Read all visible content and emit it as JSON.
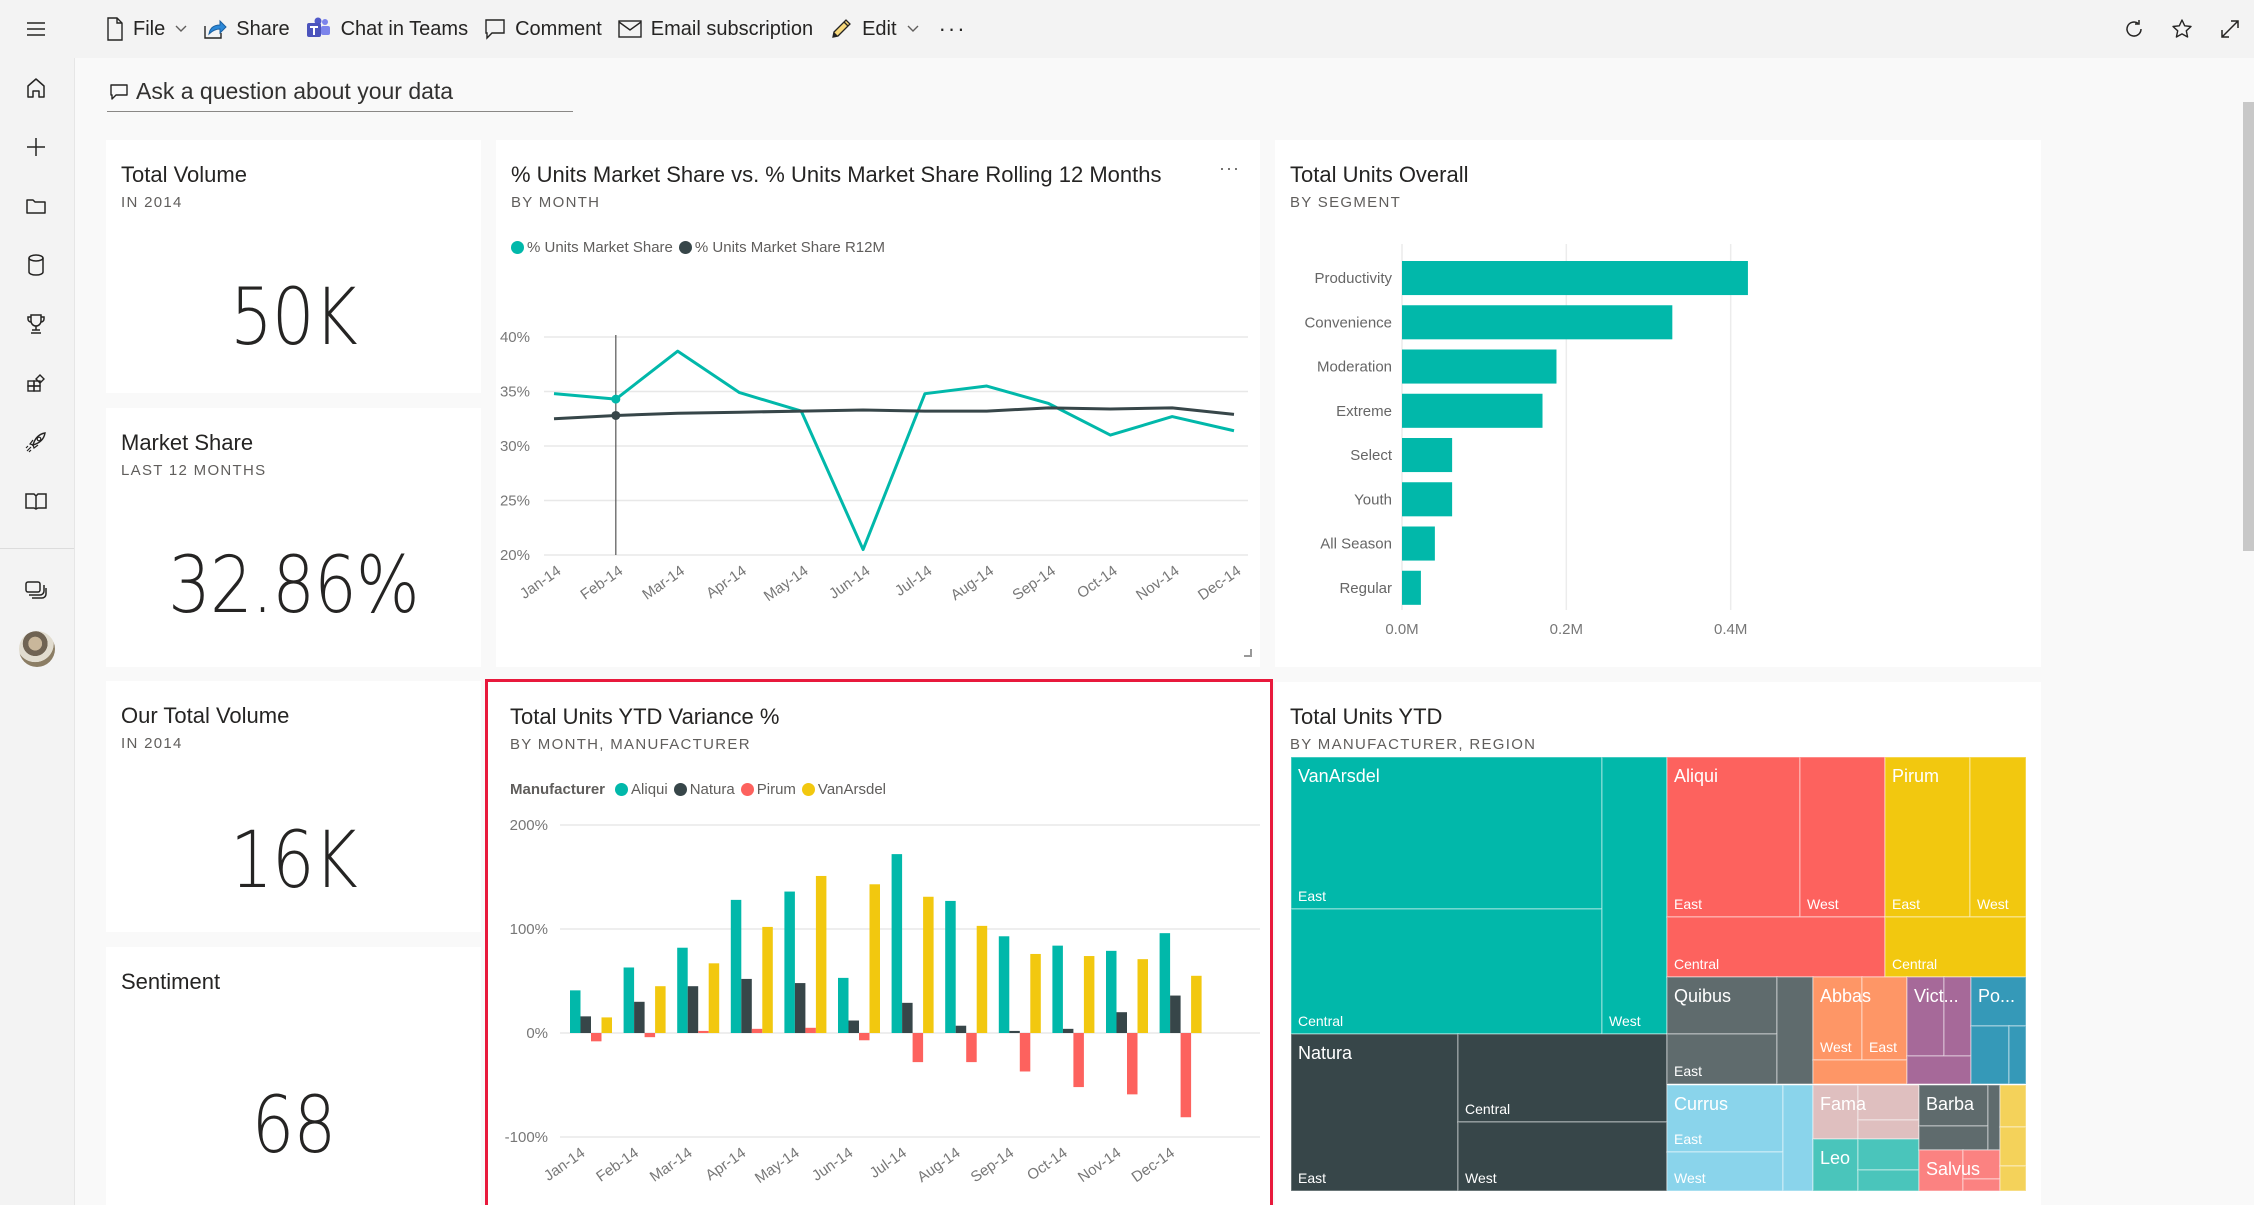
{
  "toolbar": {
    "items": [
      {
        "label": "File",
        "icon": "file-icon",
        "has_dropdown": true
      },
      {
        "label": "Share",
        "icon": "share-icon"
      },
      {
        "label": "Chat in Teams",
        "icon": "teams-icon"
      },
      {
        "label": "Comment",
        "icon": "comment-icon"
      },
      {
        "label": "Email subscription",
        "icon": "email-icon"
      },
      {
        "label": "Edit",
        "icon": "edit-icon",
        "has_dropdown": true
      }
    ],
    "more_label": "···",
    "right_icons": [
      "refresh-icon",
      "favorite-star-icon",
      "fullscreen-icon"
    ]
  },
  "sidebar": {
    "items": [
      "home-icon",
      "create-plus-icon",
      "browse-folder-icon",
      "data-hub-cylinder-icon",
      "goals-trophy-icon",
      "apps-icon",
      "learn-rocket-icon",
      "workspaces-book-icon"
    ],
    "bottom_items": [
      "workspaces-stack-icon",
      "avatar"
    ]
  },
  "qna": {
    "placeholder": "Ask a question about your data"
  },
  "colors": {
    "teal": "#01B8AA",
    "dark": "#374649",
    "red": "#FD625E",
    "yellow": "#F2C80F",
    "selection": "#E8193C"
  },
  "tiles": {
    "total_volume": {
      "title": "Total Volume",
      "subtitle": "IN 2014",
      "value": "50K"
    },
    "market_share": {
      "title": "Market Share",
      "subtitle": "LAST 12 MONTHS",
      "value": "32.86%"
    },
    "our_total_volume": {
      "title": "Our Total Volume",
      "subtitle": "IN 2014",
      "value": "16K"
    },
    "sentiment": {
      "title": "Sentiment",
      "value": "68"
    },
    "line_chart": {
      "title": "% Units Market Share vs. % Units Market Share Rolling 12 Months",
      "subtitle": "BY MONTH",
      "more_label": "···"
    },
    "bar_chart": {
      "title": "Total Units Overall",
      "subtitle": "BY SEGMENT"
    },
    "column_chart": {
      "title": "Total Units YTD Variance %",
      "subtitle": "BY MONTH, MANUFACTURER"
    },
    "treemap": {
      "title": "Total Units YTD",
      "subtitle": "BY MANUFACTURER, REGION"
    }
  },
  "chart_data": [
    {
      "id": "line_chart",
      "type": "line",
      "title": "% Units Market Share vs. % Units Market Share Rolling 12 Months",
      "subtitle": "BY MONTH",
      "x": [
        "Jan-14",
        "Feb-14",
        "Mar-14",
        "Apr-14",
        "May-14",
        "Jun-14",
        "Jul-14",
        "Aug-14",
        "Sep-14",
        "Oct-14",
        "Nov-14",
        "Dec-14"
      ],
      "series": [
        {
          "name": "% Units Market Share",
          "color": "#01B8AA",
          "values": [
            34.8,
            34.3,
            38.7,
            34.9,
            33.2,
            20.5,
            34.8,
            35.5,
            33.9,
            31.0,
            32.7,
            31.4
          ]
        },
        {
          "name": "% Units Market Share R12M",
          "color": "#374649",
          "values": [
            32.5,
            32.8,
            33.0,
            33.1,
            33.2,
            33.3,
            33.2,
            33.2,
            33.5,
            33.4,
            33.5,
            32.9
          ]
        }
      ],
      "yticks": [
        "20%",
        "25%",
        "30%",
        "35%",
        "40%"
      ],
      "ylim": [
        20,
        40
      ],
      "grid": true,
      "legend": "top-left",
      "hover_category": "Feb-14"
    },
    {
      "id": "bar_chart",
      "type": "bar",
      "orientation": "horizontal",
      "title": "Total Units Overall",
      "subtitle": "BY SEGMENT",
      "categories": [
        "Productivity",
        "Convenience",
        "Moderation",
        "Extreme",
        "Select",
        "Youth",
        "All Season",
        "Regular"
      ],
      "values": [
        0.421,
        0.329,
        0.188,
        0.171,
        0.061,
        0.061,
        0.04,
        0.023
      ],
      "unit": "M",
      "xticks": [
        "0.0M",
        "0.2M",
        "0.4M"
      ],
      "xlim": [
        0,
        0.5
      ],
      "color": "#01B8AA",
      "grid": true
    },
    {
      "id": "column_chart",
      "type": "bar",
      "orientation": "vertical",
      "title": "Total Units YTD Variance %",
      "subtitle": "BY MONTH, MANUFACTURER",
      "legend_title": "Manufacturer",
      "categories": [
        "Jan-14",
        "Feb-14",
        "Mar-14",
        "Apr-14",
        "May-14",
        "Jun-14",
        "Jul-14",
        "Aug-14",
        "Sep-14",
        "Oct-14",
        "Nov-14",
        "Dec-14"
      ],
      "series": [
        {
          "name": "Aliqui",
          "color": "#01B8AA",
          "values": [
            41,
            63,
            82,
            128,
            136,
            53,
            172,
            127,
            93,
            84,
            79,
            96
          ]
        },
        {
          "name": "Natura",
          "color": "#374649",
          "values": [
            16,
            30,
            45,
            52,
            48,
            12,
            29,
            7,
            2,
            4,
            20,
            36
          ]
        },
        {
          "name": "Pirum",
          "color": "#FD625E",
          "values": [
            -8,
            -4,
            2,
            4,
            5,
            -7,
            -28,
            -28,
            -37,
            -52,
            -59,
            -81
          ]
        },
        {
          "name": "VanArsdel",
          "color": "#F2C80F",
          "values": [
            15,
            45,
            67,
            102,
            151,
            143,
            131,
            103,
            76,
            74,
            71,
            55
          ]
        }
      ],
      "yticks": [
        "-100%",
        "0%",
        "100%",
        "200%"
      ],
      "ylim": [
        -100,
        200
      ],
      "grid": true,
      "legend": "top-left"
    },
    {
      "id": "treemap",
      "type": "treemap",
      "title": "Total Units YTD",
      "subtitle": "BY MANUFACTURER, REGION",
      "groups": [
        {
          "name": "VanArsdel",
          "color": "#01B8AA",
          "regions": [
            "East",
            "Central",
            "West"
          ]
        },
        {
          "name": "Aliqui",
          "color": "#FD625E",
          "regions": [
            "East",
            "West",
            "Central"
          ]
        },
        {
          "name": "Pirum",
          "color": "#F2C80F",
          "regions": [
            "East",
            "West",
            "Central"
          ]
        },
        {
          "name": "Natura",
          "color": "#374649",
          "regions": [
            "East",
            "Central",
            "West"
          ]
        },
        {
          "name": "Quibus",
          "color": "#5F6B6D",
          "regions": [
            "East"
          ]
        },
        {
          "name": "Abbas",
          "color": "#FE9666",
          "regions": [
            "West",
            "East"
          ]
        },
        {
          "name": "Vict...",
          "color": "#A66999",
          "regions": []
        },
        {
          "name": "Po...",
          "color": "#3599B8",
          "regions": []
        },
        {
          "name": "Currus",
          "color": "#8AD4EB",
          "regions": [
            "East",
            "West"
          ]
        },
        {
          "name": "Fama",
          "color": "#DFBFBF",
          "regions": []
        },
        {
          "name": "Leo",
          "color": "#4AC5BB",
          "regions": []
        },
        {
          "name": "Barba",
          "color": "#5F6B6D",
          "regions": []
        },
        {
          "name": "Salvus",
          "color": "#FB8281",
          "regions": []
        },
        {
          "name": "",
          "color": "#F4D25A",
          "regions": []
        }
      ]
    }
  ]
}
